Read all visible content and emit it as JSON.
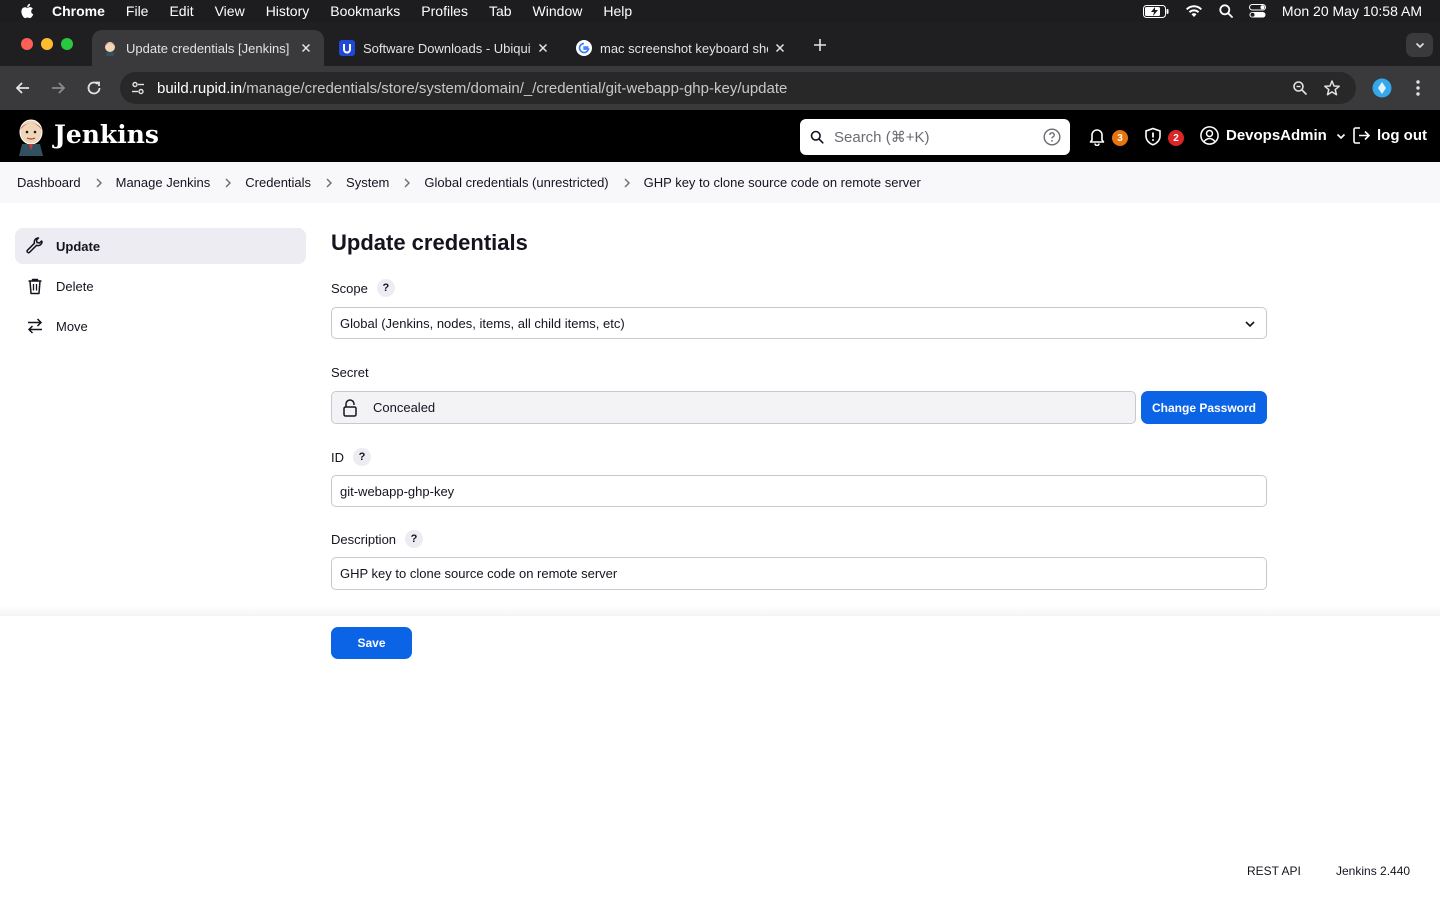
{
  "menubar": {
    "app": "Chrome",
    "items": [
      "File",
      "Edit",
      "View",
      "History",
      "Bookmarks",
      "Profiles",
      "Tab",
      "Window",
      "Help"
    ],
    "datetime": "Mon 20 May  10:58 AM"
  },
  "tabs": [
    {
      "title": "Update credentials [Jenkins]",
      "favicon": "jenkins-favicon"
    },
    {
      "title": "Software Downloads - Ubiquiti",
      "favicon": "ubiquiti-favicon"
    },
    {
      "title": "mac screenshot keyboard sho",
      "favicon": "google-favicon"
    }
  ],
  "address": {
    "host": "build.rupid.in",
    "path": "/manage/credentials/store/system/domain/_/credential/git-webapp-ghp-key/update"
  },
  "jenkins": {
    "title": "Jenkins",
    "search_placeholder": "Search (⌘+K)",
    "notifications_count": "3",
    "security_count": "2",
    "user": "DevopsAdmin",
    "logout": "log out"
  },
  "breadcrumbs": [
    "Dashboard",
    "Manage Jenkins",
    "Credentials",
    "System",
    "Global credentials (unrestricted)",
    "GHP key to clone source code on remote server"
  ],
  "side": {
    "items": [
      {
        "label": "Update",
        "icon": "wrench-icon"
      },
      {
        "label": "Delete",
        "icon": "trash-icon"
      },
      {
        "label": "Move",
        "icon": "arrows-swap-icon"
      }
    ]
  },
  "form": {
    "title": "Update credentials",
    "scope_label": "Scope",
    "scope_value": "Global (Jenkins, nodes, items, all child items, etc)",
    "secret_label": "Secret",
    "secret_value": "Concealed",
    "change_password": "Change Password",
    "id_label": "ID",
    "id_value": "git-webapp-ghp-key",
    "description_label": "Description",
    "description_value": "GHP key to clone source code on remote server",
    "help": "?",
    "save": "Save"
  },
  "footer": {
    "rest_api": "REST API",
    "version": "Jenkins 2.440"
  },
  "colors": {
    "primary": "#0b63e5",
    "notification_badge": "#e8740c",
    "security_badge": "#d92626"
  }
}
